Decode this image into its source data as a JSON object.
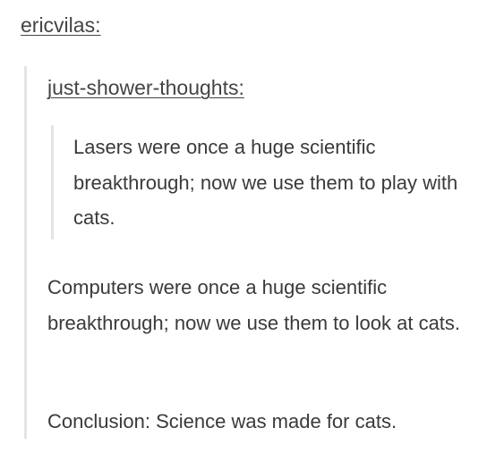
{
  "post": {
    "reblogger": "ericvilas:",
    "quoted": {
      "author": "just-shower-thoughts:",
      "text": "Lasers were once a huge scientific breakthrough; now we use them to play with cats."
    },
    "reply": {
      "paragraph_1": "Computers were once a huge scientific breakthrough; now we use them to look at cats.",
      "paragraph_2": "Conclusion: Science was made for cats."
    }
  },
  "colors": {
    "text": "#3a3a3a",
    "username": "#444444",
    "quote_border": "#e4e4e4",
    "background": "#ffffff"
  }
}
